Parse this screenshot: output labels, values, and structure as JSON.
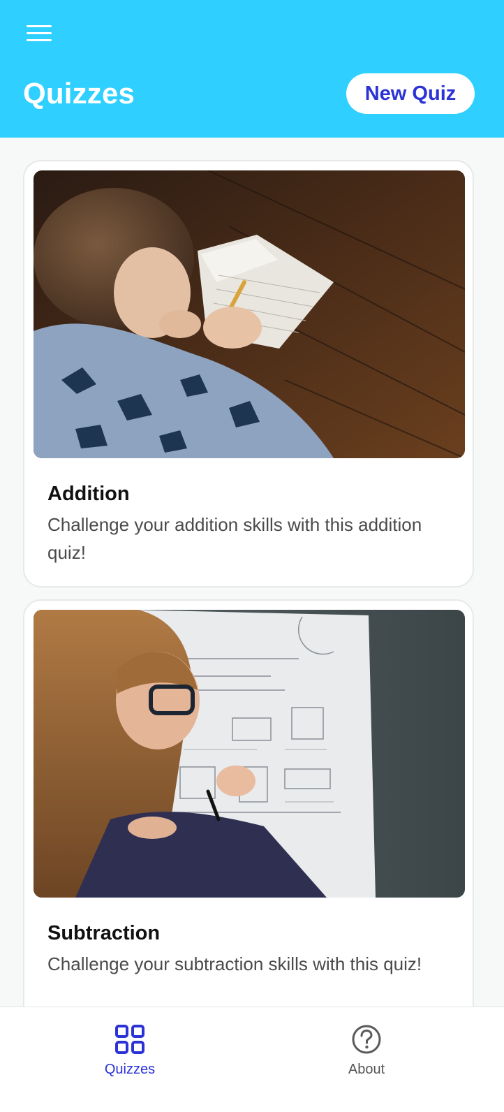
{
  "header": {
    "title": "Quizzes",
    "new_quiz_label": "New Quiz",
    "menu_icon": "hamburger-menu-icon",
    "background_color": "#2fd0ff"
  },
  "quizzes": [
    {
      "title": "Addition",
      "description": "Challenge your addition skills with this addition quiz!",
      "image": "boy-doing-worksheet-photo"
    },
    {
      "title": "Subtraction",
      "description": "Challenge your subtraction skills with this quiz!",
      "image": "girl-doing-worksheet-photo"
    }
  ],
  "tabbar": {
    "tabs": [
      {
        "label": "Quizzes",
        "icon": "grid-icon",
        "active": true
      },
      {
        "label": "About",
        "icon": "help-circle-icon",
        "active": false
      }
    ],
    "active_color": "#2b33d6",
    "inactive_color": "#555555"
  }
}
